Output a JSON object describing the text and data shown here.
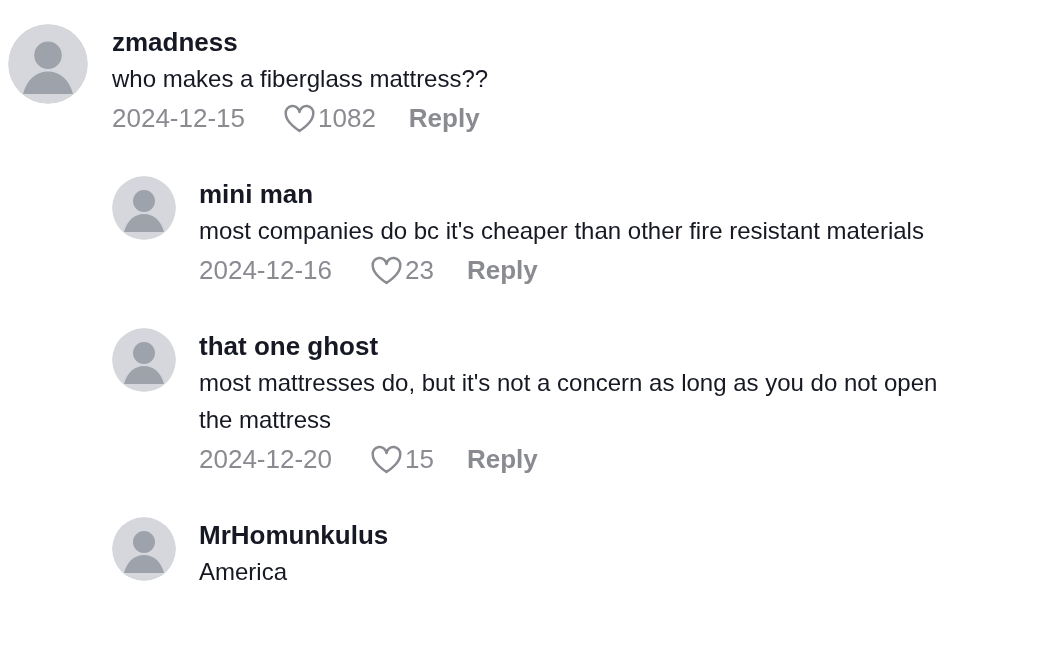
{
  "comments": [
    {
      "author": "zmadness",
      "text": "who makes a fiberglass mattress??",
      "date": "2024-12-15",
      "likes": "1082",
      "reply_label": "Reply",
      "replies": [
        {
          "author": "mini man",
          "text": "most companies do bc it's cheaper than other fire resistant materials",
          "date": "2024-12-16",
          "likes": "23",
          "reply_label": "Reply"
        },
        {
          "author": "that one ghost",
          "text": "most mattresses do, but it's not a concern as long as you do not open the mattress",
          "date": "2024-12-20",
          "likes": "15",
          "reply_label": "Reply"
        },
        {
          "author": "MrHomunkulus",
          "text": "America"
        }
      ]
    }
  ]
}
